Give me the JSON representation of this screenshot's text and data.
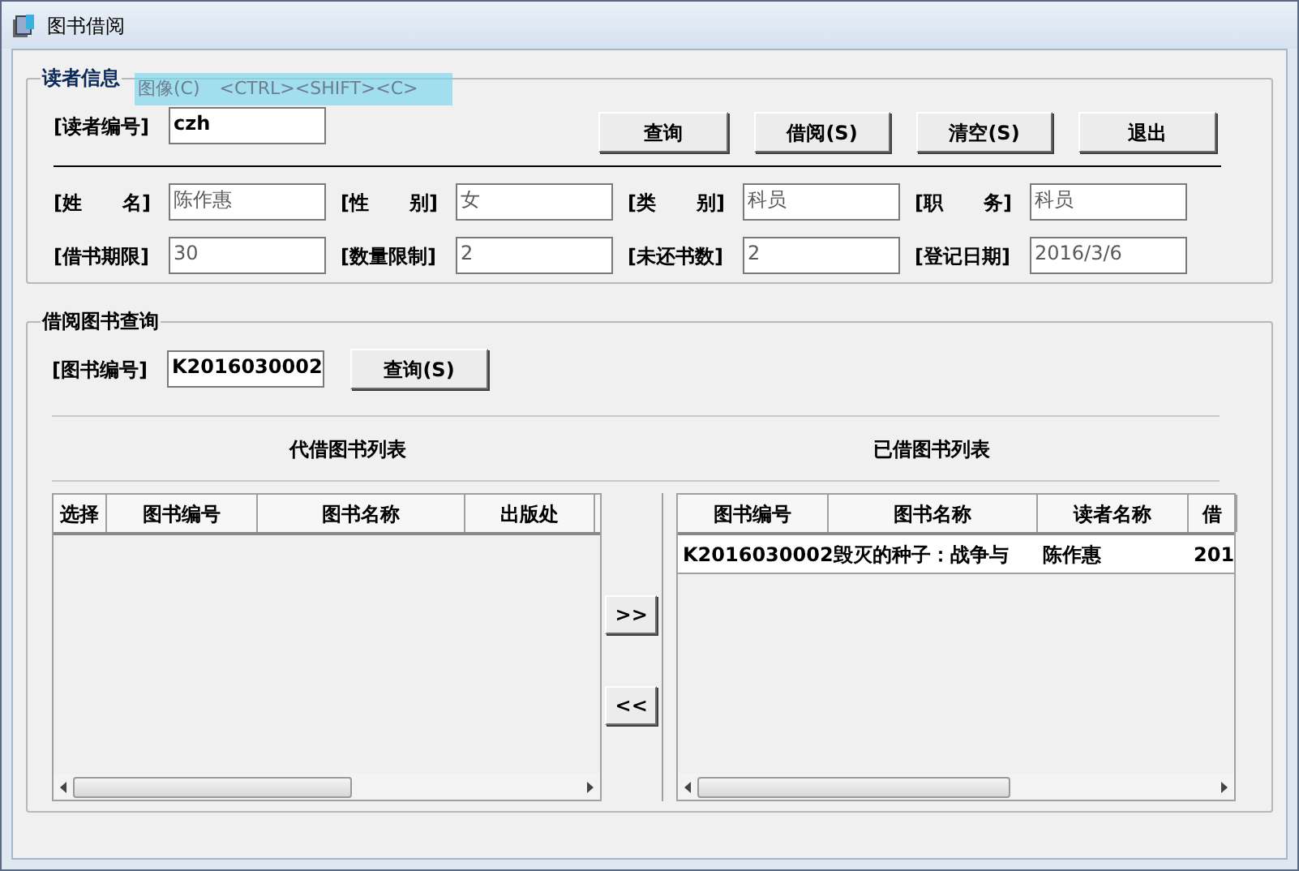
{
  "window": {
    "title": "图书借阅"
  },
  "tooltip": {
    "label": "图像(C)",
    "shortcut": "<CTRL><SHIFT><C>"
  },
  "reader_info": {
    "title": "读者信息",
    "id_field": {
      "label": "[读者编号]",
      "value": "czh",
      "disabled": false
    },
    "buttons": [
      "查询",
      "借阅(S)",
      "清空(S)",
      "退出"
    ],
    "fields": [
      [
        {
          "label": "[姓      名]",
          "value": "陈作惠",
          "disabled": true
        },
        {
          "label": "[性      别]",
          "value": "女",
          "disabled": true
        },
        {
          "label": "[类      别]",
          "value": "科员",
          "disabled": true
        },
        {
          "label": "[职      务]",
          "value": "科员",
          "disabled": true
        }
      ],
      [
        {
          "label": "[借书期限]",
          "value": "30",
          "disabled": true
        },
        {
          "label": "[数量限制]",
          "value": "2",
          "disabled": true
        },
        {
          "label": "[未还书数]",
          "value": "2",
          "disabled": true
        },
        {
          "label": "[登记日期]",
          "value": "2016/3/6",
          "disabled": true
        }
      ]
    ]
  },
  "book_query": {
    "title": "借阅图书查询",
    "book_field": {
      "label": "[图书编号]",
      "value": "K2016030002",
      "disabled": false
    },
    "query_button": "查询(S)",
    "pending_table": {
      "title": "代借图书列表",
      "columns": [
        "选择",
        "图书编号",
        "图书名称",
        "出版处"
      ]
    },
    "move_buttons": [
      ">>",
      "<<"
    ],
    "borrowed_table": {
      "title": "已借图书列表",
      "columns": [
        "图书编号",
        "图书名称",
        "读者名称",
        "借"
      ],
      "rows": [
        [
          "K2016030002",
          "毁灭的种子：战争与",
          "陈作惠",
          "201"
        ]
      ]
    }
  }
}
